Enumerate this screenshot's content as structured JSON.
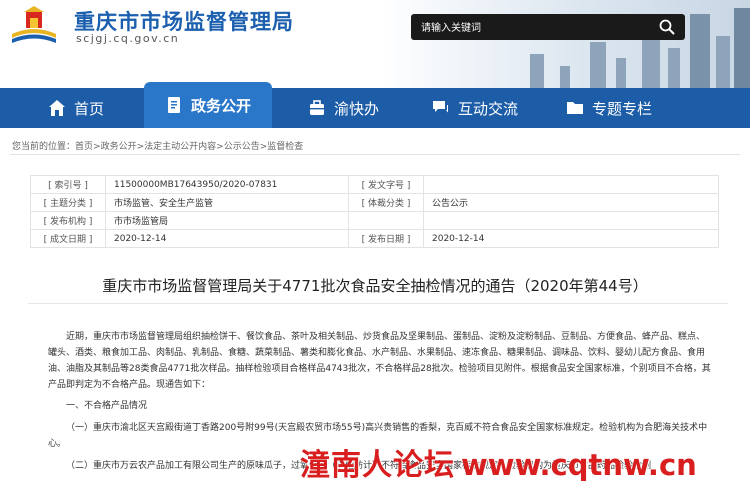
{
  "header": {
    "site_name": "重庆市市场监督管理局",
    "site_domain": "scjgj.cq.gov.cn",
    "search_placeholder": "请输入关键词"
  },
  "nav": {
    "items": [
      {
        "label": "首页",
        "icon": "home-icon"
      },
      {
        "label": "政务公开",
        "icon": "document-icon",
        "active": true
      },
      {
        "label": "渝快办",
        "icon": "briefcase-icon"
      },
      {
        "label": "互动交流",
        "icon": "chat-icon"
      },
      {
        "label": "专题专栏",
        "icon": "folder-icon"
      }
    ]
  },
  "breadcrumb": {
    "prefix": "您当前的位置：",
    "path": [
      "首页",
      "政务公开",
      "法定主动公开内容",
      "公示公告",
      "监督检查"
    ],
    "separator": ">"
  },
  "meta": {
    "index_no_label": "[ 索引号 ]",
    "index_no": "11500000MB17643950/2020-07831",
    "doc_no_label": "[ 发文字号 ]",
    "doc_no": "",
    "topic_label": "[ 主题分类 ]",
    "topic": "市场监管、安全生产监管",
    "genre_label": "[ 体裁分类 ]",
    "genre": "公告公示",
    "issuer_label": "[ 发布机构 ]",
    "issuer": "市市场监管局",
    "created_label": "[ 成文日期 ]",
    "created": "2020-12-14",
    "published_label": "[ 发布日期 ]",
    "published": "2020-12-14"
  },
  "article": {
    "title": "重庆市市场监督管理局关于4771批次食品安全抽检情况的通告（2020年第44号）",
    "intro": "近期，重庆市市场监督管理局组织抽检饼干、餐饮食品、茶叶及相关制品、炒货食品及坚果制品、蛋制品、淀粉及淀粉制品、豆制品、方便食品、蜂产品、糕点、罐头、酒类、粮食加工品、肉制品、乳制品、食糖、蔬菜制品、薯类和膨化食品、水产制品、水果制品、速冻食品、糖果制品、调味品、饮料、婴幼儿配方食品、食用油、油脂及其制品等28类食品4771批次样品。抽样检验项目合格样品4743批次，不合格样品28批次。检验项目见附件。根据食品安全国家标准，个别项目不合格，其产品即判定为不合格产品。现通告如下：",
    "section1": "一、不合格产品情况",
    "item1": "（一）重庆市渝北区天宫殿街道丁香路200号附99号(天宫殿农贸市场55号)高兴贵销售的香梨，克百威不符合食品安全国家标准规定。检验机构为合肥海关技术中心。",
    "item2": "（二）重庆市万云农产品加工有限公司生产的原味瓜子，过氧化值（以脂肪计）不符合食品安全国家标准规定。检验机构为重庆市食品药品检验检测"
  },
  "watermark": {
    "text": "潼南人论坛",
    "url": "www.cqtnw.cn"
  },
  "colors": {
    "brand_blue": "#1d5da8",
    "nav_active": "#2a77c9",
    "watermark_red": "#d81e1e"
  }
}
